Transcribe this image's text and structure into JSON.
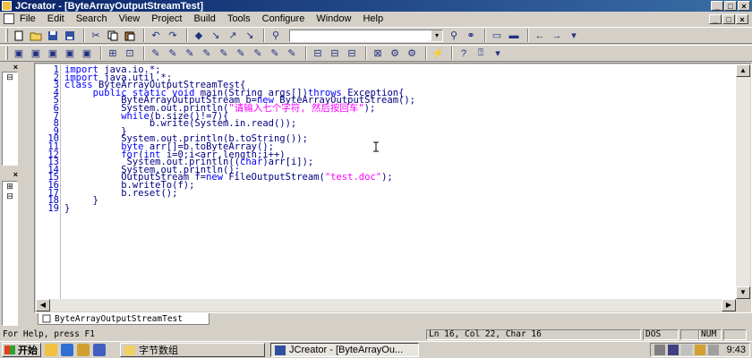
{
  "window": {
    "title": "JCreator - [ByteArrayOutputStreamTest]",
    "min_glyph": "_",
    "max_glyph": "□",
    "close_glyph": "×"
  },
  "menu": {
    "items": [
      "File",
      "Edit",
      "Search",
      "View",
      "Project",
      "Build",
      "Tools",
      "Configure",
      "Window",
      "Help"
    ]
  },
  "toolbar": {
    "find_value": "",
    "find_dropdown_glyph": "▾"
  },
  "left_panes": {
    "close_glyph": "×",
    "expand_glyph": "⊞",
    "collapse_glyph": "⊟"
  },
  "editor": {
    "line_numbers": [
      "1",
      "2",
      "3",
      "4",
      "5",
      "6",
      "7",
      "8",
      "9",
      "10",
      "11",
      "12",
      "13",
      "14",
      "15",
      "16",
      "17",
      "18",
      "19"
    ],
    "lines": [
      "import java.io.*;",
      "import java.util.*;",
      "class ByteArrayOutputStreamTest{",
      "     public static void main(String args[])throws Exception{",
      "          ByteArrayOutputStream b=new ByteArrayOutputStream();",
      "          System.out.println(\"请输入七个字符, 然后按回车\");",
      "          while(b.size()!=7){",
      "               b.write(System.in.read());",
      "          }",
      "          System.out.println(b.toString());",
      "          byte arr[]=b.toByteArray();",
      "          for(int i=0;i<arr.length;i++)",
      "           System.out.println((char)arr[i]);",
      "          System.out.println();",
      "          OutputStream f=new FileOutputStream(\"test.doc\");",
      "          b.writeTo(f);",
      "          b.reset();",
      "     }",
      "}"
    ]
  },
  "scrollbars": {
    "up": "▲",
    "down": "▼",
    "left": "◀",
    "right": "▶"
  },
  "tab": {
    "label": "ByteArrayOutputStreamTest"
  },
  "status": {
    "help": "For Help, press F1",
    "position": "Ln 16, Col 22, Char 16",
    "mode": "DOS",
    "num": "NUM"
  },
  "taskbar": {
    "start_label": "开始",
    "tasks": [
      {
        "label": "字节数组"
      },
      {
        "label": "JCreator - [ByteArrayOu..."
      }
    ],
    "clock": "9:43"
  }
}
